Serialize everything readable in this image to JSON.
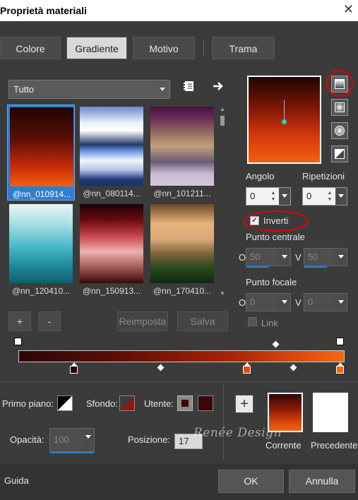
{
  "window": {
    "title": "Proprietà materiali",
    "close_glyph": "✕"
  },
  "tabs": [
    {
      "label": "Colore"
    },
    {
      "label": "Gradiente"
    },
    {
      "label": "Motivo"
    },
    {
      "label": "Trama"
    }
  ],
  "category": {
    "value": "Tutto"
  },
  "swatches": [
    {
      "label": "@nn_010914...",
      "selected": true
    },
    {
      "label": "@nn_080114..."
    },
    {
      "label": "@nn_101211..."
    },
    {
      "label": "@nn_120410..."
    },
    {
      "label": "@nn_150913..."
    },
    {
      "label": "@nn_170410..."
    }
  ],
  "swatch_buttons": {
    "add": "+",
    "remove": "-"
  },
  "actions": {
    "reset": "Reimposta",
    "save": "Salva"
  },
  "angle": {
    "label": "Angolo",
    "value": "0"
  },
  "repeats": {
    "label": "Ripetizioni",
    "value": "0"
  },
  "invert": {
    "label": "Inverti",
    "checked": true
  },
  "center_point": {
    "label": "Punto centrale",
    "o_label": "O",
    "o_value": "50",
    "v_label": "V",
    "v_value": "50"
  },
  "focal_point": {
    "label": "Punto focale",
    "o_label": "O",
    "o_value": "0",
    "v_label": "V",
    "v_value": "0"
  },
  "link": {
    "label": "Link",
    "checked": false
  },
  "bottom": {
    "foreground_label": "Primo piano:",
    "background_label": "Sfondo:",
    "user_label": "Utente:",
    "opacity_label": "Opacità:",
    "opacity_value": "100",
    "position_label": "Posizione:",
    "position_value": "17",
    "add_glyph": "+",
    "current_label": "Corrente",
    "previous_label": "Precedente"
  },
  "watermark": "Renée Design",
  "footer": {
    "help": "Guida",
    "ok": "OK",
    "cancel": "Annulla"
  },
  "colors": {
    "accent": "#2f7fd1",
    "highlight_circle": "#e00000",
    "gradient_dark": "#2a0606",
    "gradient_light": "#f26a10",
    "user_color": "#3b0606"
  }
}
